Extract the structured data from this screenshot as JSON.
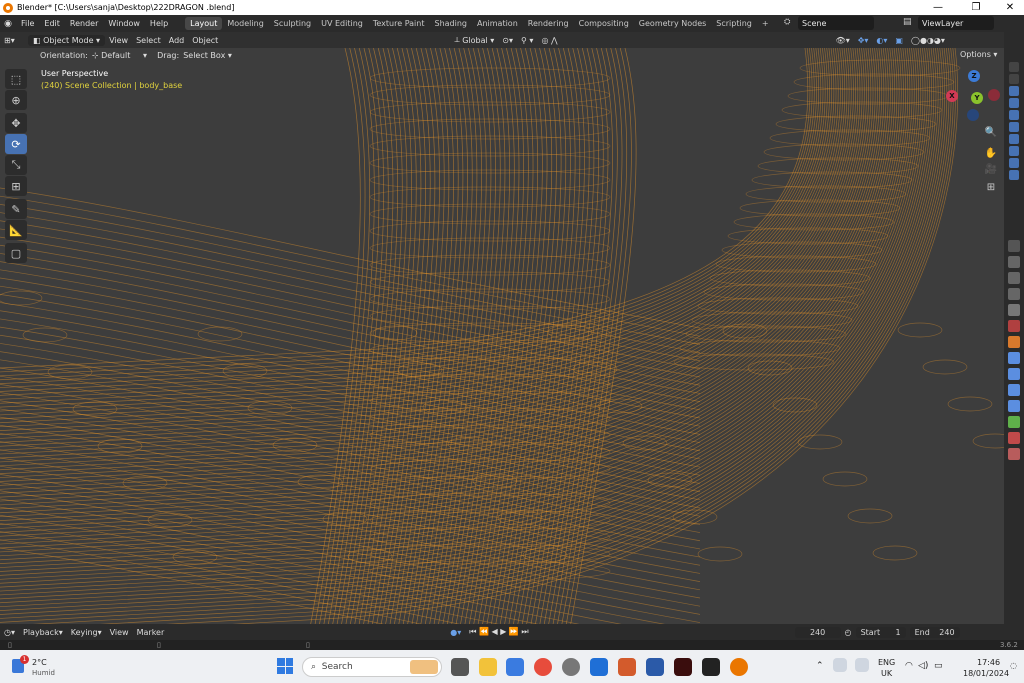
{
  "window": {
    "title": "Blender* [C:\\Users\\sanja\\Desktop\\222DRAGON .blend]",
    "minimize": "—",
    "maximize": "❐",
    "close": "✕"
  },
  "menu": {
    "items": [
      "File",
      "Edit",
      "Render",
      "Window",
      "Help"
    ]
  },
  "workspaces": [
    "Layout",
    "Modeling",
    "Sculpting",
    "UV Editing",
    "Texture Paint",
    "Shading",
    "Animation",
    "Rendering",
    "Compositing",
    "Geometry Nodes",
    "Scripting",
    "+"
  ],
  "active_workspace": "Layout",
  "scene": {
    "name": "Scene",
    "view_layer": "ViewLayer"
  },
  "header": {
    "mode": "Object Mode",
    "view": "View",
    "select": "Select",
    "add": "Add",
    "object": "Object",
    "transform_orientation": "Global"
  },
  "tool_settings": {
    "orientation_label": "Orientation:",
    "orientation_value": "Default",
    "drag_label": "Drag:",
    "drag_value": "Select Box",
    "options": "Options"
  },
  "viewport": {
    "perspective": "User Perspective",
    "collection": "(240) Scene Collection | body_base"
  },
  "gizmo": {
    "z": "Z",
    "y": "Y",
    "x": "X"
  },
  "timeline": {
    "playback": "Playback",
    "keying": "Keying",
    "view": "View",
    "marker": "Marker",
    "current_frame": "240",
    "start_label": "Start",
    "start": "1",
    "end_label": "End",
    "end": "240"
  },
  "statusbar": {
    "version": "3.6.2"
  },
  "taskbar": {
    "weather_temp": "2°C",
    "weather_desc": "Humid",
    "notification_count": "1",
    "search": "Search",
    "lang1": "ENG",
    "lang2": "UK",
    "time": "17:46",
    "date": "18/01/2024"
  },
  "colors": {
    "wire": "#e8962a",
    "viewport": "#3d3d3d",
    "accent": "#4772b3"
  }
}
